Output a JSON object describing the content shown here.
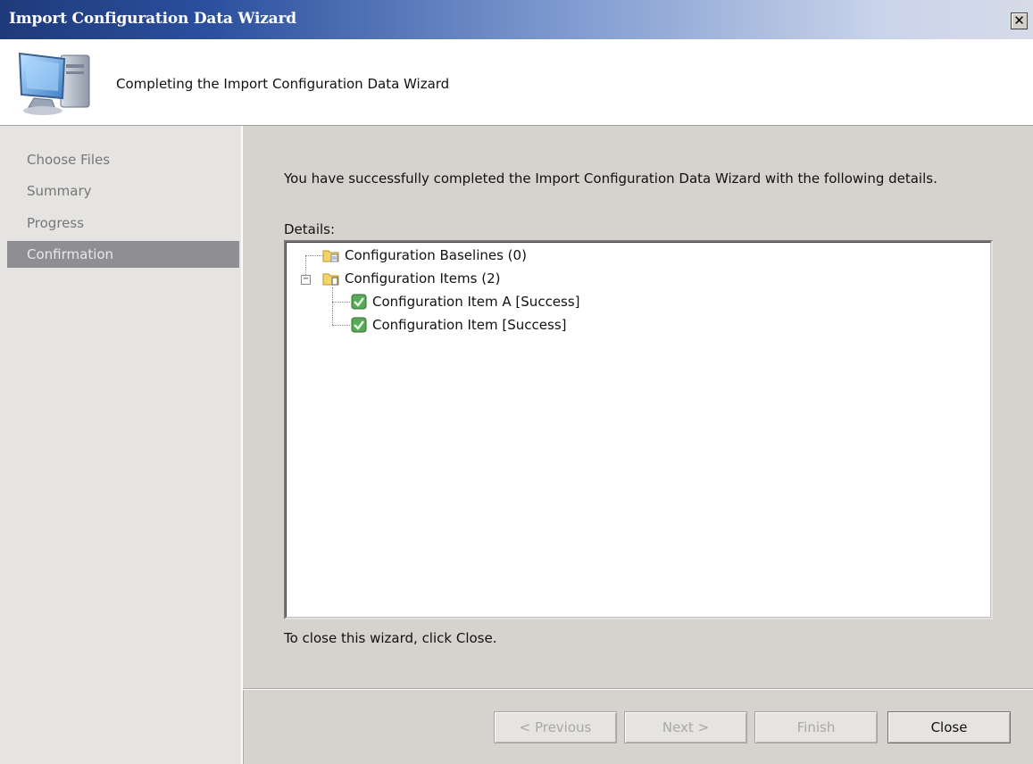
{
  "window": {
    "title": "Import Configuration Data Wizard",
    "close_glyph": "✕"
  },
  "banner": {
    "heading": "Completing the Import Configuration Data Wizard",
    "icon": "computer-icon"
  },
  "nav": {
    "items": [
      {
        "label": "Choose Files",
        "active": false
      },
      {
        "label": "Summary",
        "active": false
      },
      {
        "label": "Progress",
        "active": false
      },
      {
        "label": "Confirmation",
        "active": true
      }
    ]
  },
  "main": {
    "intro": "You have successfully completed the Import Configuration Data Wizard with the following details.",
    "details_label": "Details:",
    "tree": [
      {
        "label": "Configuration Baselines (0)",
        "icon": "folder-baseline-icon",
        "level": 0
      },
      {
        "label": "Configuration Items (2)",
        "icon": "folder-items-icon",
        "level": 0,
        "expanded": true
      },
      {
        "label": "Configuration Item A [Success]",
        "icon": "success-check-icon",
        "level": 1
      },
      {
        "label": "Configuration Item [Success]",
        "icon": "success-check-icon",
        "level": 1
      }
    ],
    "close_hint": "To close this wizard, click Close."
  },
  "buttons": {
    "previous": "< Previous",
    "next": "Next >",
    "finish": "Finish",
    "close": "Close"
  },
  "colors": {
    "titlebar_start": "#1f3a7a",
    "nav_active": "#8f8f93",
    "success": "#4a9a4a"
  }
}
